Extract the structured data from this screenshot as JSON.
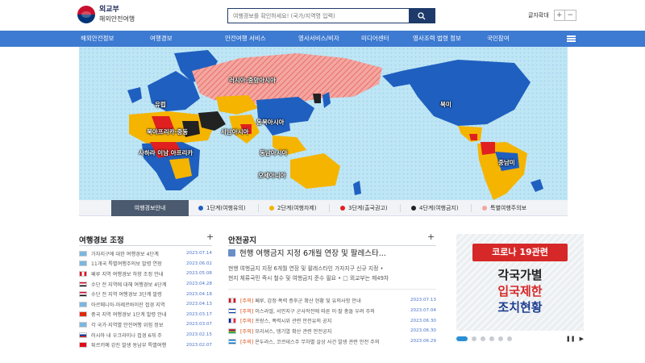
{
  "header": {
    "logo_main": "외교부",
    "logo_sub": "해외안전여행",
    "search_placeholder": "여행경보를 확인하세요! (국가/지역명 입력)",
    "font_size_label": "글자확대",
    "font_plus": "+",
    "font_minus": "−"
  },
  "nav": {
    "items": [
      "해외안전정보",
      "여행경보",
      "안전여행 서비스",
      "영사서비스/비자",
      "미디어센터",
      "영사조력 법령 정보",
      "국민참여"
    ]
  },
  "map": {
    "regions": [
      "러시아·중앙아시아",
      "유럽",
      "북미",
      "동북아시아",
      "북아프리카·중동",
      "서남아시아",
      "사하라 이남 아프리카",
      "동남아시아",
      "오세아니아",
      "중남미"
    ]
  },
  "legend": {
    "head": "여행경보안내",
    "items": [
      {
        "label": "1단계(여행유의)",
        "color": "#1f5fbf"
      },
      {
        "label": "2단계(여행자제)",
        "color": "#f5b400"
      },
      {
        "label": "3단계(출국권고)",
        "color": "#e02020"
      },
      {
        "label": "4단계(여행금지)",
        "color": "#222222"
      },
      {
        "label": "특별여행주의보",
        "color": "#f4a6a0"
      }
    ]
  },
  "travel_alerts": {
    "title": "여행경보 조정",
    "more": "+",
    "rows": [
      {
        "text": "가자지구에 대한 여행경보 4단계",
        "date": "2023.07.14"
      },
      {
        "text": "11개국 특별여행주의보 발령 연장",
        "date": "2023.06.02"
      },
      {
        "text": "페루 지역 여행경보 하향 조정 안내",
        "date": "2023.05.08"
      },
      {
        "text": "수단 전 지역에 대해 여행경보 4단계",
        "date": "2023.04.28"
      },
      {
        "text": "수단 전 지역 여행경보 3단계 발령",
        "date": "2023.04.18"
      },
      {
        "text": "아르메니아-아제르바이잔 접경 지역",
        "date": "2023.04.13"
      },
      {
        "text": "중국 지역 여행경보 1단계 발령 안내",
        "date": "2023.03.17"
      },
      {
        "text": "각 국가·지역별 안전여행 위험 정보",
        "date": "2023.03.07"
      },
      {
        "text": "러시아 내 우크라이나 접경 6개 주",
        "date": "2023.02.15"
      },
      {
        "text": "튀르키예 강진 발생 동남부 특별여행",
        "date": "2023.02.07"
      }
    ]
  },
  "safety_notice": {
    "title": "안전공지",
    "more": "+",
    "headline": "현행 여행금지 지정 6개월 연장 및 팔레스타...",
    "desc_line1": "현행 여행금지 지정 6개월 연장 및 팔레스타인 가자지구 신규 지정 •",
    "desc_line2": "현지 체류국민 즉시 철수 및 여행금지 준수 필요 • □ 외교부는 제49차",
    "rows": [
      {
        "tag": "[주의]",
        "text": "페루, 감정·폭력 증후군 확산 현황 및 유의사항 안내",
        "date": "2023.07.13"
      },
      {
        "tag": "[주의]",
        "text": "이스라엘, 서안지구 군사작전에 따른 이·팔 충돌 우려 주의",
        "date": "2023.07.04"
      },
      {
        "tag": "[주의]",
        "text": "프랑스, 폭력시위 관련 안전유의 공지",
        "date": "2023.06.30"
      },
      {
        "tag": "[주의]",
        "text": "모리셔스, 뎅기열 확산 관련 안전공지",
        "date": "2023.06.30"
      },
      {
        "tag": "[주의]",
        "text": "온두라스, 코르테스주 무차별 살상 사건 발생 관련 안전 주의",
        "date": "2023.06.29"
      }
    ]
  },
  "banner": {
    "pill": "코로나 19관련",
    "line1": "각국가별",
    "line2": "입국제한",
    "line3": "조치현황",
    "pause": "❚❚",
    "play": "▶"
  }
}
